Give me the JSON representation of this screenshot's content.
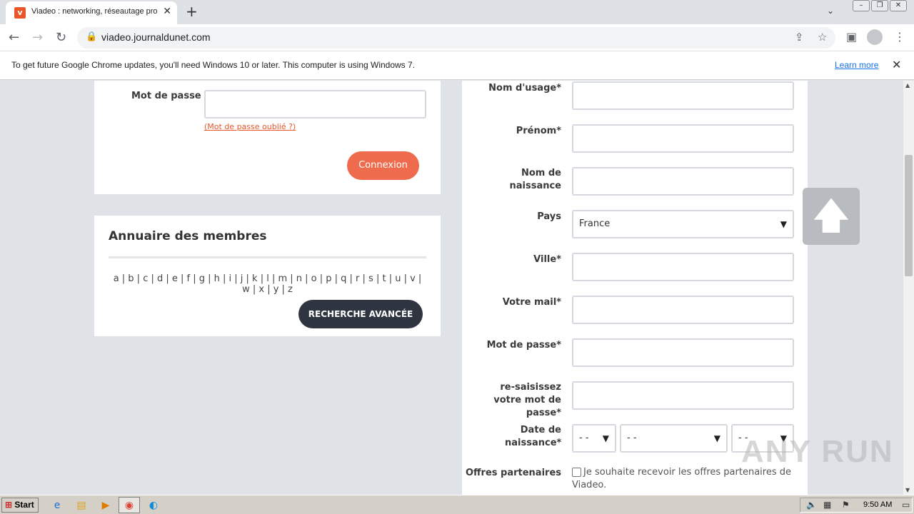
{
  "browser": {
    "tab_title": "Viadeo : networking, réseautage pro",
    "url": "viadeo.journaldunet.com",
    "infobar_text": "To get future Google Chrome updates, you'll need Windows 10 or later. This computer is using Windows 7.",
    "learn_more": "Learn more"
  },
  "login": {
    "password_label": "Mot de passe",
    "forgot_link": "(Mot de passe oublié ?)",
    "connect_button": "Connexion"
  },
  "annuaire": {
    "title": "Annuaire des membres",
    "alphabet": "a | b | c | d | e | f | g | h | i | j | k | l | m | n | o | p | q | r | s | t | u | v | w | x | y | z",
    "advanced_search": "RECHERCHE AVANCÉE"
  },
  "register": {
    "nom_usage": "Nom d'usage*",
    "prenom": "Prénom*",
    "nom_naissance": "Nom de naissance",
    "pays": "Pays",
    "pays_value": "France",
    "ville": "Ville*",
    "mail": "Votre mail*",
    "password": "Mot de passe*",
    "password_confirm": "re-saisissez votre mot de passe*",
    "date_naissance": "Date de naissance*",
    "day_value": "- -",
    "month_value": "- -",
    "year_value": "- -",
    "offres_label": "Offres partenaires",
    "offres_text": "Je souhaite recevoir les offres partenaires de Viadeo."
  },
  "taskbar": {
    "start": "Start",
    "clock": "9:50 AM"
  },
  "watermark": "ANY RUN"
}
